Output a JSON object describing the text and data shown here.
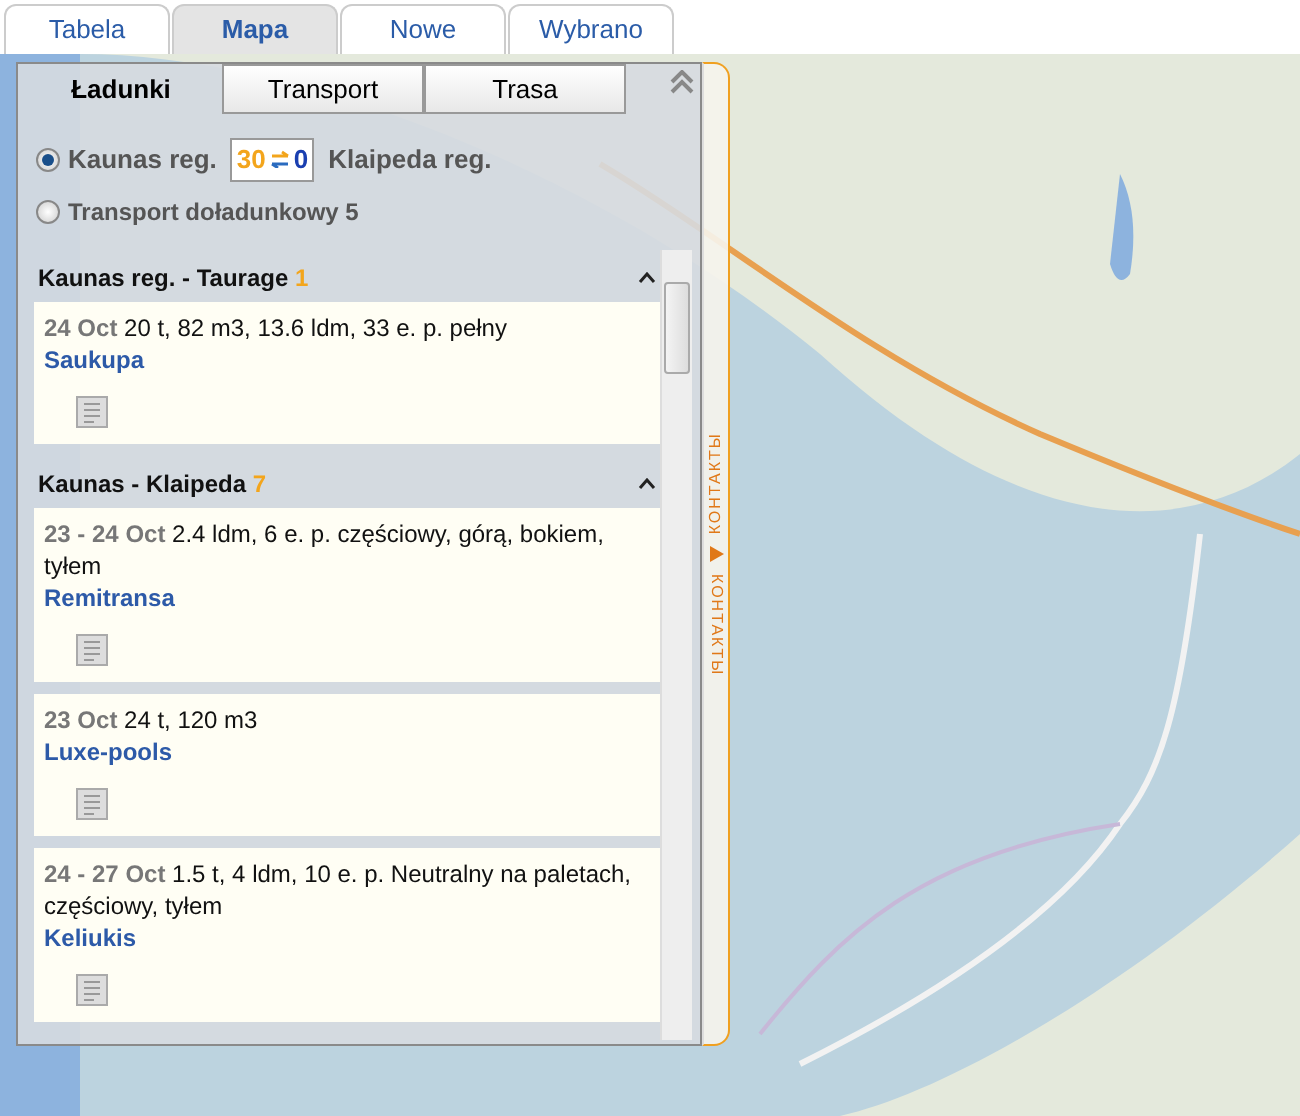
{
  "top_tabs": [
    {
      "label": "Tabela",
      "selected": false
    },
    {
      "label": "Mapa",
      "selected": true
    },
    {
      "label": "Nowe",
      "selected": false
    },
    {
      "label": "Wybrano",
      "selected": false
    }
  ],
  "panel": {
    "tabs": [
      {
        "label": "Ładunki",
        "selected": true
      },
      {
        "label": "Transport",
        "selected": false
      },
      {
        "label": "Trasa",
        "selected": false
      }
    ],
    "options": [
      {
        "kind": "route",
        "selected": true,
        "from": "Kaunas reg.",
        "count_from": "30",
        "count_to": "0",
        "to": "Klaipeda reg."
      },
      {
        "kind": "plain",
        "selected": false,
        "label": "Transport doładunkowy 5"
      }
    ],
    "groups": [
      {
        "title": "Kaunas reg. - Taurage",
        "count": "1",
        "expanded": true,
        "items": [
          {
            "date": "24 Oct",
            "details": "20 t, 82 m3, 13.6 ldm, 33 e. p. pełny",
            "company": "Saukupa"
          }
        ]
      },
      {
        "title": "Kaunas - Klaipeda",
        "count": "7",
        "expanded": true,
        "items": [
          {
            "date": "23 - 24 Oct",
            "details": "2.4 ldm, 6 e. p. częściowy, górą, bokiem, tyłem",
            "company": "Remitransa"
          },
          {
            "date": "23 Oct",
            "details": "24 t, 120 m3",
            "company": "Luxe-pools"
          },
          {
            "date": "24 - 27 Oct",
            "details": "1.5 t, 4 ldm, 10 e. p. Neutralny na paletach, częściowy, tyłem",
            "company": "Keliukis"
          }
        ]
      }
    ],
    "side_label_top": "КОНТАКТЫ",
    "side_label_bottom": "КОНТАКТЫ"
  }
}
